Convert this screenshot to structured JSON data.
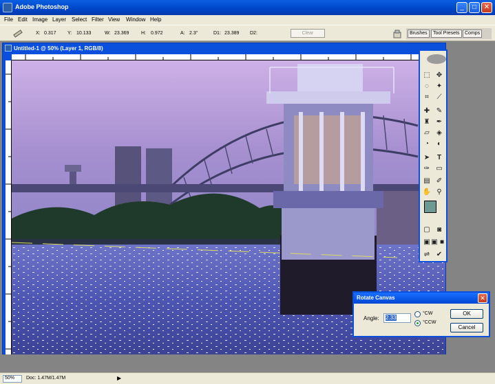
{
  "app": {
    "title": "Adobe Photoshop"
  },
  "window_controls": {
    "minimize": "_",
    "maximize": "□",
    "close": "✕"
  },
  "menu": [
    "File",
    "Edit",
    "Image",
    "Layer",
    "Select",
    "Filter",
    "View",
    "Window",
    "Help"
  ],
  "options_bar": {
    "x_label": "X:",
    "x_value": "0.317",
    "y_label": "Y:",
    "y_value": "10.133",
    "w_label": "W:",
    "w_value": "23.369",
    "h_label": "H:",
    "h_value": "0.972",
    "a_label": "A:",
    "a_value": "2.3°",
    "d1_label": "D1:",
    "d1_value": "23.389",
    "d2_label": "D2:",
    "clear_label": "Clear",
    "well_tabs": [
      "Brushes",
      "Tool Presets",
      "Comps"
    ]
  },
  "document": {
    "title": "Untitled-1 @ 50% (Layer 1, RGB/8)"
  },
  "dialog": {
    "title": "Rotate Canvas",
    "angle_label": "Angle:",
    "angle_value": "2.33",
    "cw_label": "°CW",
    "ccw_label": "°CCW",
    "ok_label": "OK",
    "cancel_label": "Cancel"
  },
  "status": {
    "zoom": "50%",
    "doc": "Doc: 1.47M/1.47M"
  },
  "colors": {
    "foreground": "#6e9a94",
    "background": "#ffffff",
    "accent": "#0a50dd"
  }
}
